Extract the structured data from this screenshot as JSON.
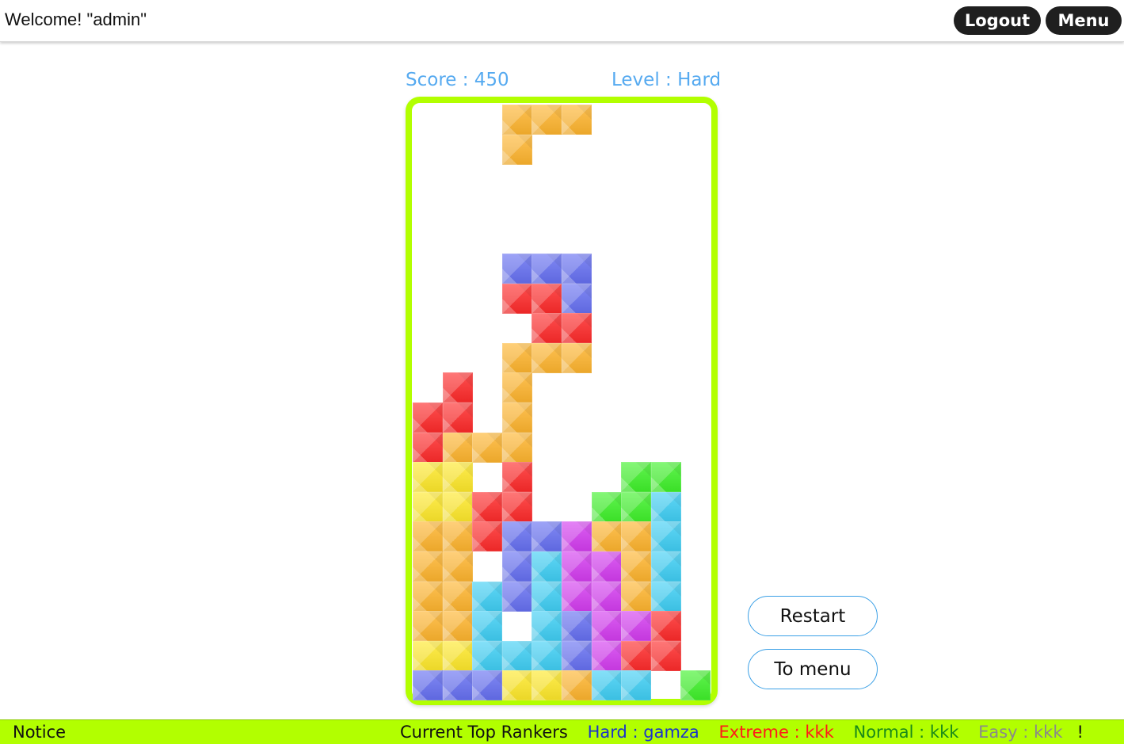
{
  "header": {
    "welcome": "Welcome! \"admin\"",
    "logout_label": "Logout",
    "menu_label": "Menu"
  },
  "game": {
    "score_text": "Score : 450",
    "level_text": "Level : Hard",
    "score": 450,
    "level": "Hard",
    "grid": {
      "columns": 10,
      "rows": 20,
      "cells": [
        [
          3,
          0,
          "orange"
        ],
        [
          4,
          0,
          "orange"
        ],
        [
          5,
          0,
          "orange"
        ],
        [
          3,
          1,
          "orange"
        ],
        [
          3,
          5,
          "blue"
        ],
        [
          4,
          5,
          "blue"
        ],
        [
          5,
          5,
          "blue"
        ],
        [
          3,
          6,
          "red"
        ],
        [
          4,
          6,
          "red"
        ],
        [
          5,
          6,
          "blue"
        ],
        [
          4,
          7,
          "red"
        ],
        [
          5,
          7,
          "red"
        ],
        [
          3,
          8,
          "orange"
        ],
        [
          4,
          8,
          "orange"
        ],
        [
          5,
          8,
          "orange"
        ],
        [
          1,
          9,
          "red"
        ],
        [
          3,
          9,
          "orange"
        ],
        [
          0,
          10,
          "red"
        ],
        [
          1,
          10,
          "red"
        ],
        [
          3,
          10,
          "orange"
        ],
        [
          0,
          11,
          "red"
        ],
        [
          1,
          11,
          "orange"
        ],
        [
          2,
          11,
          "orange"
        ],
        [
          3,
          11,
          "orange"
        ],
        [
          0,
          12,
          "yellow"
        ],
        [
          1,
          12,
          "yellow"
        ],
        [
          3,
          12,
          "red"
        ],
        [
          7,
          12,
          "green"
        ],
        [
          8,
          12,
          "green"
        ],
        [
          0,
          13,
          "yellow"
        ],
        [
          1,
          13,
          "yellow"
        ],
        [
          2,
          13,
          "red"
        ],
        [
          3,
          13,
          "red"
        ],
        [
          6,
          13,
          "green"
        ],
        [
          7,
          13,
          "green"
        ],
        [
          8,
          13,
          "cyan"
        ],
        [
          0,
          14,
          "orange"
        ],
        [
          1,
          14,
          "orange"
        ],
        [
          2,
          14,
          "red"
        ],
        [
          3,
          14,
          "blue"
        ],
        [
          4,
          14,
          "blue"
        ],
        [
          5,
          14,
          "magenta"
        ],
        [
          6,
          14,
          "orange"
        ],
        [
          7,
          14,
          "orange"
        ],
        [
          8,
          14,
          "cyan"
        ],
        [
          0,
          15,
          "orange"
        ],
        [
          1,
          15,
          "orange"
        ],
        [
          3,
          15,
          "blue"
        ],
        [
          4,
          15,
          "cyan"
        ],
        [
          5,
          15,
          "magenta"
        ],
        [
          6,
          15,
          "magenta"
        ],
        [
          7,
          15,
          "orange"
        ],
        [
          8,
          15,
          "cyan"
        ],
        [
          0,
          16,
          "orange"
        ],
        [
          1,
          16,
          "orange"
        ],
        [
          2,
          16,
          "cyan"
        ],
        [
          3,
          16,
          "blue"
        ],
        [
          4,
          16,
          "cyan"
        ],
        [
          5,
          16,
          "magenta"
        ],
        [
          6,
          16,
          "magenta"
        ],
        [
          7,
          16,
          "orange"
        ],
        [
          8,
          16,
          "cyan"
        ],
        [
          0,
          17,
          "orange"
        ],
        [
          1,
          17,
          "orange"
        ],
        [
          2,
          17,
          "cyan"
        ],
        [
          4,
          17,
          "cyan"
        ],
        [
          5,
          17,
          "blue"
        ],
        [
          6,
          17,
          "magenta"
        ],
        [
          7,
          17,
          "magenta"
        ],
        [
          8,
          17,
          "red"
        ],
        [
          0,
          18,
          "yellow"
        ],
        [
          1,
          18,
          "yellow"
        ],
        [
          2,
          18,
          "cyan"
        ],
        [
          3,
          18,
          "cyan"
        ],
        [
          4,
          18,
          "cyan"
        ],
        [
          5,
          18,
          "blue"
        ],
        [
          6,
          18,
          "magenta"
        ],
        [
          7,
          18,
          "red"
        ],
        [
          8,
          18,
          "red"
        ],
        [
          0,
          19,
          "blue"
        ],
        [
          1,
          19,
          "blue"
        ],
        [
          2,
          19,
          "blue"
        ],
        [
          3,
          19,
          "yellow"
        ],
        [
          4,
          19,
          "yellow"
        ],
        [
          5,
          19,
          "orange"
        ],
        [
          6,
          19,
          "cyan"
        ],
        [
          7,
          19,
          "cyan"
        ],
        [
          9,
          19,
          "green"
        ]
      ]
    },
    "colors": {
      "orange": "#ffb52e",
      "blue": "#6670f2",
      "red": "#ff2a2a",
      "yellow": "#ffe92a",
      "green": "#3ff22a",
      "cyan": "#3fcff5",
      "magenta": "#d43cf0",
      "border": "#b2ff00",
      "accent_text": "#56aaf0"
    }
  },
  "controls": {
    "restart_label": "Restart",
    "to_menu_label": "To menu"
  },
  "footer": {
    "notice": "Notice",
    "rankers_title": "Current Top Rankers",
    "hard": "Hard : gamza",
    "extreme": "Extreme : kkk",
    "normal": "Normal : kkk",
    "easy": "Easy : kkk",
    "end": "!"
  }
}
